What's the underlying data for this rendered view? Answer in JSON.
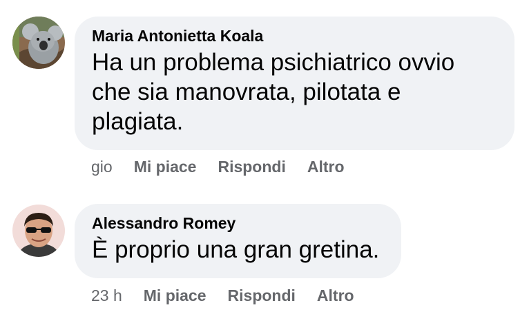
{
  "comments": [
    {
      "author": "Maria Antonietta Koala",
      "avatar_icon": "koala-avatar",
      "text": "Ha un problema psichiatrico ovvio che sia manovrata, pilotata e plagiata.",
      "time": "gio",
      "like_label": "Mi piace",
      "reply_label": "Rispondi",
      "more_label": "Altro"
    },
    {
      "author": "Alessandro Romey",
      "avatar_icon": "man-sunglasses-avatar",
      "text": "È proprio una gran gretina.",
      "time": "23 h",
      "like_label": "Mi piace",
      "reply_label": "Rispondi",
      "more_label": "Altro"
    }
  ],
  "colors": {
    "bubble_bg": "#f0f2f5",
    "text": "#050505",
    "secondary": "#65676b"
  }
}
